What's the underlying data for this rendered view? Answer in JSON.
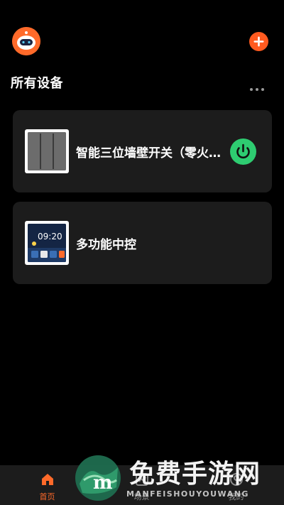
{
  "header": {
    "avatar_icon": "robot-avatar-icon",
    "add_icon": "plus-icon",
    "accent_color": "#ff5a1f"
  },
  "section": {
    "title": "所有设备",
    "more_icon": "more-dots-icon"
  },
  "devices": [
    {
      "name": "智能三位墙壁开关（零火版）",
      "thumbnail": "three-gang-wall-switch",
      "power_icon": "power-icon",
      "power_color": "#2ecc71"
    },
    {
      "name": "多功能中控",
      "thumbnail": "control-panel-screen",
      "screen_time": "09:20"
    }
  ],
  "tabbar": {
    "tabs": [
      {
        "label": "首页",
        "icon": "home-icon",
        "active": true
      },
      {
        "label": "场景",
        "icon": "scene-icon",
        "active": false
      },
      {
        "label": "我的",
        "icon": "profile-icon",
        "active": false
      }
    ],
    "active_color": "#ff6a2a"
  },
  "watermark": {
    "cn_text": "免费手游网",
    "en_text": "MANFEISHOUYOUWANG"
  }
}
